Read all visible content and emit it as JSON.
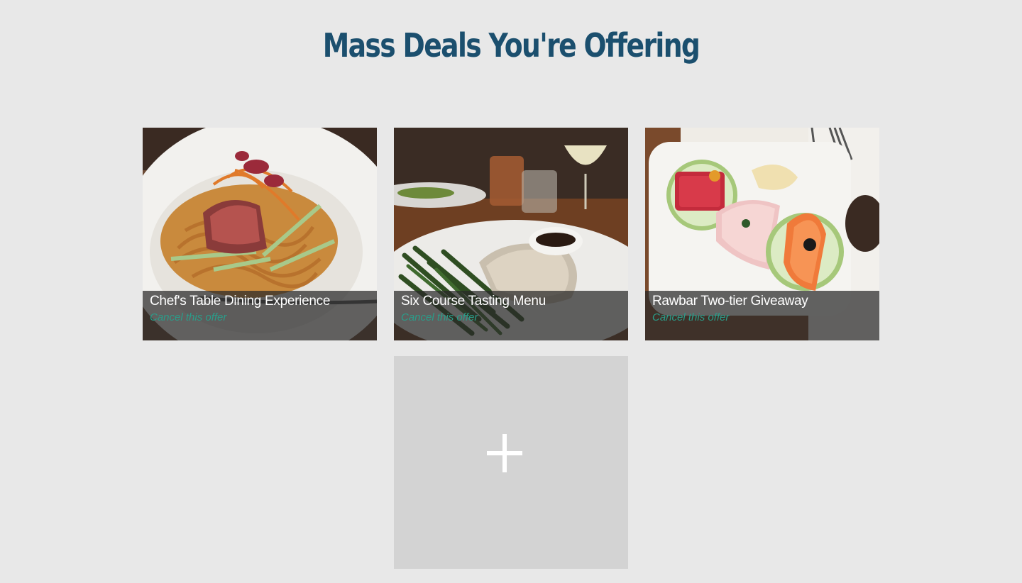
{
  "page": {
    "title": "Mass Deals You're Offering"
  },
  "deals": [
    {
      "title": "Chef's Table Dining Experience",
      "cancel_label": "Cancel this offer",
      "photo": "noodles-with-seared-beef"
    },
    {
      "title": "Six Course Tasting Menu",
      "cancel_label": "Cancel this offer",
      "photo": "grilled-fish-with-green-beans"
    },
    {
      "title": "Rawbar Two-tier Giveaway",
      "cancel_label": "Cancel this offer",
      "photo": "sashimi-plate"
    }
  ],
  "add_tile": {
    "icon": "plus-icon"
  },
  "colors": {
    "background": "#e8e8e8",
    "title": "#1b4f6e",
    "cancel_link": "#2a9d8a",
    "add_tile": "#d3d3d3"
  }
}
